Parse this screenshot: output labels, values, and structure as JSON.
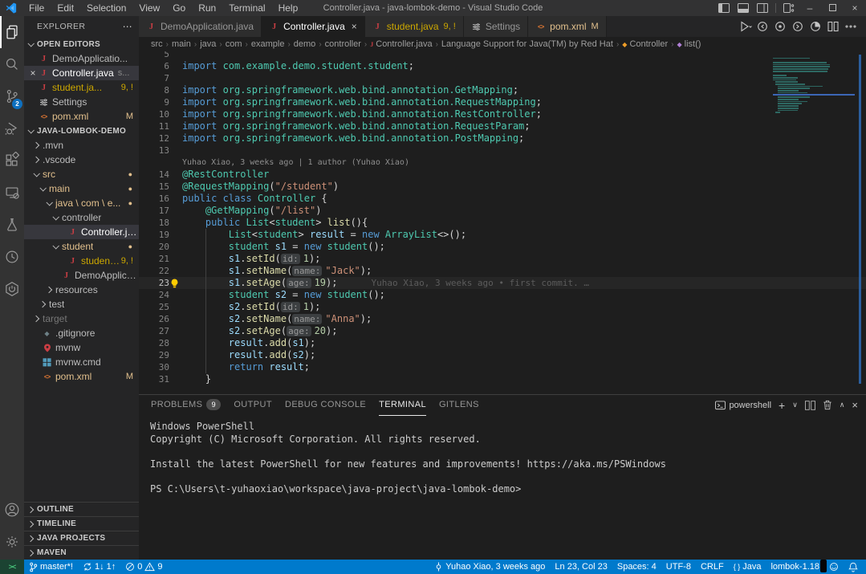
{
  "window": {
    "title": "Controller.java - java-lombok-demo - Visual Studio Code"
  },
  "menu": [
    "File",
    "Edit",
    "Selection",
    "View",
    "Go",
    "Run",
    "Terminal",
    "Help"
  ],
  "activity_bar": {
    "items": [
      {
        "name": "explorer",
        "active": true
      },
      {
        "name": "search"
      },
      {
        "name": "source-control",
        "badge": "2"
      },
      {
        "name": "run-and-debug"
      },
      {
        "name": "extensions"
      },
      {
        "name": "remote-explorer"
      },
      {
        "name": "testing"
      },
      {
        "name": "gitlens"
      },
      {
        "name": "spring-boot-dashboard"
      }
    ],
    "bottom": [
      {
        "name": "accounts"
      },
      {
        "name": "settings"
      }
    ]
  },
  "sidebar": {
    "title": "EXPLORER",
    "more": "⋯",
    "open_editors": {
      "header": "OPEN EDITORS",
      "items": [
        {
          "icon": "java",
          "label": "DemoApplicatio..."
        },
        {
          "icon": "java",
          "label": "Controller.java",
          "detail": "s...",
          "selected": true,
          "close": "×"
        },
        {
          "icon": "java",
          "label": "student.ja...",
          "badge": "9, !",
          "color": "warning"
        },
        {
          "icon": "settings",
          "label": "Settings"
        },
        {
          "icon": "xml",
          "label": "pom.xml",
          "badge": "M",
          "color": "modified"
        }
      ]
    },
    "project": {
      "header": "JAVA-LOMBOK-DEMO",
      "tree": [
        {
          "label": ".mvn",
          "type": "folder",
          "chev": "right",
          "depth": 1
        },
        {
          "label": ".vscode",
          "type": "folder",
          "chev": "right",
          "depth": 1
        },
        {
          "label": "src",
          "type": "folder",
          "chev": "down",
          "depth": 1,
          "color": "modified",
          "dot": true
        },
        {
          "label": "main",
          "type": "folder",
          "chev": "down",
          "depth": 2,
          "color": "modified",
          "dot": true
        },
        {
          "label": "java \\ com \\ e...",
          "type": "folder",
          "chev": "down",
          "depth": 3,
          "color": "modified",
          "dot": true
        },
        {
          "label": "controller",
          "type": "folder",
          "chev": "down",
          "depth": 4
        },
        {
          "label": "Controller.java",
          "type": "java",
          "depth": 5,
          "selected": true
        },
        {
          "label": "student",
          "type": "folder",
          "chev": "down",
          "depth": 4,
          "color": "modified",
          "dot": true
        },
        {
          "label": "student.ja...",
          "type": "java",
          "depth": 5,
          "color": "warning",
          "badge": "9, !"
        },
        {
          "label": "DemoApplication...",
          "type": "java",
          "depth": 4
        },
        {
          "label": "resources",
          "type": "folder",
          "chev": "right",
          "depth": 3
        },
        {
          "label": "test",
          "type": "folder",
          "chev": "right",
          "depth": 2
        },
        {
          "label": "target",
          "type": "folder",
          "chev": "right",
          "depth": 1,
          "color": "dim"
        },
        {
          "label": ".gitignore",
          "type": "git",
          "depth": 1
        },
        {
          "label": "mvnw",
          "type": "pin",
          "depth": 1
        },
        {
          "label": "mvnw.cmd",
          "type": "cmd",
          "depth": 1
        },
        {
          "label": "pom.xml",
          "type": "xml",
          "depth": 1,
          "color": "modified",
          "badge": "M"
        }
      ]
    },
    "bottom_sections": [
      "OUTLINE",
      "TIMELINE",
      "JAVA PROJECTS",
      "MAVEN"
    ]
  },
  "tabs": [
    {
      "icon": "java",
      "label": "DemoApplication.java"
    },
    {
      "icon": "java",
      "label": "Controller.java",
      "active": true,
      "close": "×"
    },
    {
      "icon": "java",
      "label": "student.java",
      "badge": "9, !",
      "color": "warning"
    },
    {
      "icon": "settings",
      "label": "Settings"
    },
    {
      "icon": "xml",
      "label": "pom.xml",
      "badge": "M",
      "color": "modified"
    }
  ],
  "breadcrumb": [
    {
      "label": "src"
    },
    {
      "label": "main"
    },
    {
      "label": "java"
    },
    {
      "label": "com"
    },
    {
      "label": "example"
    },
    {
      "label": "demo"
    },
    {
      "label": "controller"
    },
    {
      "label": "Controller.java",
      "icon": "java"
    },
    {
      "label": "Language Support for Java(TM) by Red Hat"
    },
    {
      "label": "Controller",
      "icon": "class"
    },
    {
      "label": "list()",
      "icon": "method"
    }
  ],
  "editor": {
    "codelens": "Yuhao Xiao, 3 weeks ago | 1 author (Yuhao Xiao)",
    "blame_line23": "Yuhao Xiao, 3 weeks ago • first commit. …",
    "lines": [
      {
        "n": "5",
        "ind": 0,
        "tok": []
      },
      {
        "n": "6",
        "ind": 0,
        "tok": [
          [
            "kw",
            "import"
          ],
          [
            "ns",
            " com.example.demo.student.student"
          ],
          [
            "pn",
            ";"
          ]
        ]
      },
      {
        "n": "7",
        "ind": 0,
        "tok": []
      },
      {
        "n": "8",
        "ind": 0,
        "tok": [
          [
            "kw",
            "import"
          ],
          [
            "ns",
            " org.springframework.web.bind.annotation.GetMapping"
          ],
          [
            "pn",
            ";"
          ]
        ]
      },
      {
        "n": "9",
        "ind": 0,
        "tok": [
          [
            "kw",
            "import"
          ],
          [
            "ns",
            " org.springframework.web.bind.annotation.RequestMapping"
          ],
          [
            "pn",
            ";"
          ]
        ]
      },
      {
        "n": "10",
        "ind": 0,
        "tok": [
          [
            "kw",
            "import"
          ],
          [
            "ns",
            " org.springframework.web.bind.annotation.RestController"
          ],
          [
            "pn",
            ";"
          ]
        ]
      },
      {
        "n": "11",
        "ind": 0,
        "tok": [
          [
            "kw",
            "import"
          ],
          [
            "ns",
            " org.springframework.web.bind.annotation.RequestParam"
          ],
          [
            "pn",
            ";"
          ]
        ]
      },
      {
        "n": "12",
        "ind": 0,
        "tok": [
          [
            "kw",
            "import"
          ],
          [
            "ns",
            " org.springframework.web.bind.annotation.PostMapping"
          ],
          [
            "pn",
            ";"
          ]
        ]
      },
      {
        "n": "13",
        "ind": 0,
        "tok": []
      },
      {
        "lens": true
      },
      {
        "n": "14",
        "ind": 0,
        "tok": [
          [
            "ty",
            "@RestController"
          ]
        ]
      },
      {
        "n": "15",
        "ind": 0,
        "tok": [
          [
            "ty",
            "@RequestMapping"
          ],
          [
            "pn",
            "("
          ],
          [
            "st",
            "\"/student\""
          ],
          [
            "pn",
            ")"
          ]
        ]
      },
      {
        "n": "16",
        "ind": 0,
        "tok": [
          [
            "kw",
            "public class"
          ],
          [
            "ty",
            " Controller"
          ],
          [
            "pn",
            " {"
          ]
        ]
      },
      {
        "n": "17",
        "ind": 1,
        "tok": [
          [
            "ty",
            "@GetMapping"
          ],
          [
            "pn",
            "("
          ],
          [
            "st",
            "\"/list\""
          ],
          [
            "pn",
            ")"
          ]
        ]
      },
      {
        "n": "18",
        "ind": 1,
        "tok": [
          [
            "kw",
            "public"
          ],
          [
            "ty",
            " List"
          ],
          [
            "pn",
            "<"
          ],
          [
            "ty",
            "student"
          ],
          [
            "pn",
            ">"
          ],
          [
            "fn",
            " list"
          ],
          [
            "pn",
            "(){"
          ]
        ]
      },
      {
        "n": "19",
        "ind": 2,
        "tok": [
          [
            "ty",
            "List"
          ],
          [
            "pn",
            "<"
          ],
          [
            "ty",
            "student"
          ],
          [
            "pn",
            ">"
          ],
          [
            "vr",
            " result"
          ],
          [
            "pn",
            " ="
          ],
          [
            "kw",
            " new"
          ],
          [
            "ty",
            " ArrayList"
          ],
          [
            "pn",
            "<>();"
          ]
        ]
      },
      {
        "n": "20",
        "ind": 2,
        "tok": [
          [
            "ty",
            "student"
          ],
          [
            "vr",
            " s1"
          ],
          [
            "pn",
            " ="
          ],
          [
            "kw",
            " new"
          ],
          [
            "ty",
            " student"
          ],
          [
            "pn",
            "();"
          ]
        ]
      },
      {
        "n": "21",
        "ind": 2,
        "tok": [
          [
            "vr",
            "s1"
          ],
          [
            "pn",
            "."
          ],
          [
            "fn",
            "setId"
          ],
          [
            "pn",
            "("
          ],
          [
            "ph",
            "id:"
          ],
          [
            "nm",
            "1"
          ],
          [
            "pn",
            ");"
          ]
        ]
      },
      {
        "n": "22",
        "ind": 2,
        "tok": [
          [
            "vr",
            "s1"
          ],
          [
            "pn",
            "."
          ],
          [
            "fn",
            "setName"
          ],
          [
            "pn",
            "("
          ],
          [
            "ph",
            "name:"
          ],
          [
            "st",
            "\"Jack\""
          ],
          [
            "pn",
            ");"
          ]
        ]
      },
      {
        "n": "23",
        "ind": 2,
        "cur": true,
        "bulb": true,
        "blame": true,
        "tok": [
          [
            "vr",
            "s1"
          ],
          [
            "pn",
            "."
          ],
          [
            "fn",
            "setAge"
          ],
          [
            "pn",
            "("
          ],
          [
            "ph",
            "age:"
          ],
          [
            "nm",
            "19"
          ],
          [
            "pn",
            ");"
          ]
        ]
      },
      {
        "n": "24",
        "ind": 2,
        "tok": [
          [
            "ty",
            "student"
          ],
          [
            "vr",
            " s2"
          ],
          [
            "pn",
            " ="
          ],
          [
            "kw",
            " new"
          ],
          [
            "ty",
            " student"
          ],
          [
            "pn",
            "();"
          ]
        ]
      },
      {
        "n": "25",
        "ind": 2,
        "tok": [
          [
            "vr",
            "s2"
          ],
          [
            "pn",
            "."
          ],
          [
            "fn",
            "setId"
          ],
          [
            "pn",
            "("
          ],
          [
            "ph",
            "id:"
          ],
          [
            "nm",
            "1"
          ],
          [
            "pn",
            ");"
          ]
        ]
      },
      {
        "n": "26",
        "ind": 2,
        "tok": [
          [
            "vr",
            "s2"
          ],
          [
            "pn",
            "."
          ],
          [
            "fn",
            "setName"
          ],
          [
            "pn",
            "("
          ],
          [
            "ph",
            "name:"
          ],
          [
            "st",
            "\"Anna\""
          ],
          [
            "pn",
            ");"
          ]
        ]
      },
      {
        "n": "27",
        "ind": 2,
        "tok": [
          [
            "vr",
            "s2"
          ],
          [
            "pn",
            "."
          ],
          [
            "fn",
            "setAge"
          ],
          [
            "pn",
            "("
          ],
          [
            "ph",
            "age:"
          ],
          [
            "nm",
            "20"
          ],
          [
            "pn",
            ");"
          ]
        ]
      },
      {
        "n": "28",
        "ind": 2,
        "tok": [
          [
            "vr",
            "result"
          ],
          [
            "pn",
            "."
          ],
          [
            "fn",
            "add"
          ],
          [
            "pn",
            "("
          ],
          [
            "vr",
            "s1"
          ],
          [
            "pn",
            ");"
          ]
        ]
      },
      {
        "n": "29",
        "ind": 2,
        "tok": [
          [
            "vr",
            "result"
          ],
          [
            "pn",
            "."
          ],
          [
            "fn",
            "add"
          ],
          [
            "pn",
            "("
          ],
          [
            "vr",
            "s2"
          ],
          [
            "pn",
            ");"
          ]
        ]
      },
      {
        "n": "30",
        "ind": 2,
        "tok": [
          [
            "kw",
            "return"
          ],
          [
            "vr",
            " result"
          ],
          [
            "pn",
            ";"
          ]
        ]
      },
      {
        "n": "31",
        "ind": 1,
        "tok": [
          [
            "pn",
            "}"
          ]
        ]
      }
    ]
  },
  "panel": {
    "tabs": [
      {
        "label": "PROBLEMS",
        "badge": "9"
      },
      {
        "label": "OUTPUT"
      },
      {
        "label": "DEBUG CONSOLE"
      },
      {
        "label": "TERMINAL",
        "active": true
      },
      {
        "label": "GITLENS"
      }
    ],
    "shell_label": "powershell",
    "terminal_lines": [
      "Windows PowerShell",
      "Copyright (C) Microsoft Corporation. All rights reserved.",
      "",
      "Install the latest PowerShell for new features and improvements! https://aka.ms/PSWindows",
      "",
      "PS C:\\Users\\t-yuhaoxiao\\workspace\\java-project\\java-lombok-demo>"
    ]
  },
  "status_bar": {
    "branch": "master*!",
    "sync": "1↓ 1↑",
    "errors": "0",
    "warnings": "9",
    "blame": "Yuhao Xiao, 3 weeks ago",
    "position": "Ln 23, Col 23",
    "indentation": "Spaces: 4",
    "encoding": "UTF-8",
    "eol": "CRLF",
    "language_icon": "{ }",
    "language": "Java",
    "lombok": "lombok-1.18"
  }
}
